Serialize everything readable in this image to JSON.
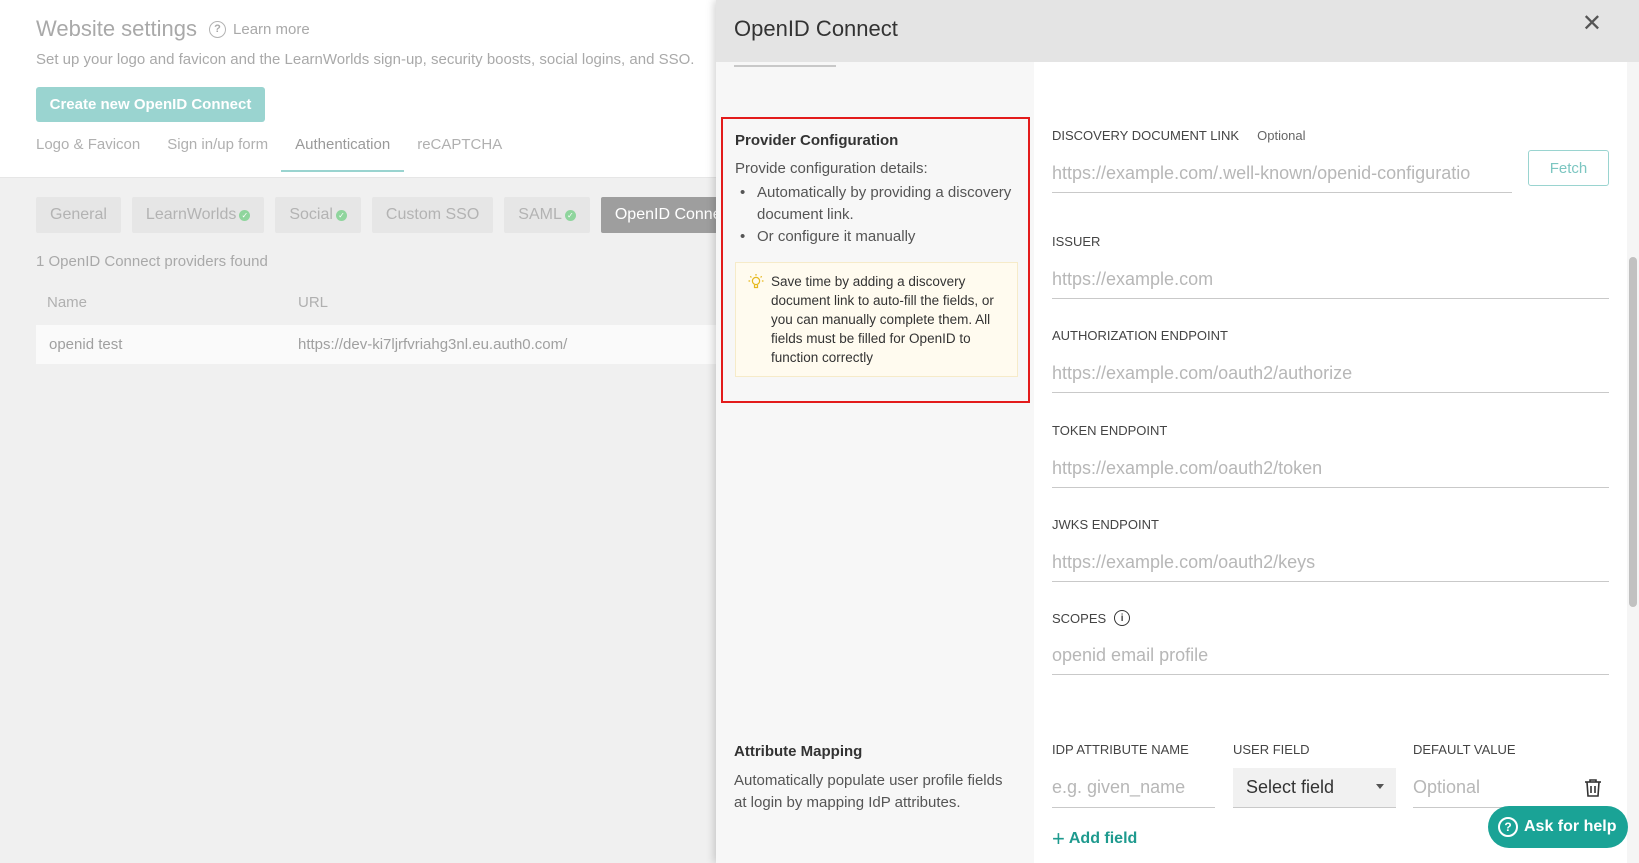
{
  "background": {
    "title": "Website settings",
    "learn_more": "Learn more",
    "subtitle": "Set up your logo and favicon and the LearnWorlds sign-up, security boosts, social logins, and SSO.",
    "create_button": "Create new OpenID Connect",
    "main_tabs": [
      "Logo & Favicon",
      "Sign in/up form",
      "Authentication",
      "reCAPTCHA"
    ],
    "active_main_tab": "Authentication",
    "sub_tabs": [
      "General",
      "LearnWorlds",
      "Social",
      "Custom SSO",
      "SAML",
      "OpenID Conne"
    ],
    "active_sub_tab": "OpenID Conne",
    "providers_found": "1 OpenID Connect providers found",
    "table": {
      "columns": [
        "Name",
        "URL"
      ],
      "rows": [
        [
          "openid test",
          "https://dev-ki7ljrfvriahg3nl.eu.auth0.com/"
        ]
      ]
    }
  },
  "drawer": {
    "title": "OpenID Connect",
    "provider_config": {
      "title": "Provider Configuration",
      "description": "Provide configuration details:",
      "items": [
        "Automatically by providing a discovery document link.",
        "Or configure it manually"
      ],
      "tip": "Save time by adding a discovery document link to auto-fill the fields, or you can manually complete them. All fields must be filled for OpenID to function correctly"
    },
    "fields": {
      "discovery": {
        "label": "DISCOVERY DOCUMENT LINK",
        "optional": "Optional",
        "placeholder": "https://example.com/.well-known/openid-configuratio",
        "button": "Fetch"
      },
      "issuer": {
        "label": "ISSUER",
        "placeholder": "https://example.com"
      },
      "authorization": {
        "label": "AUTHORIZATION ENDPOINT",
        "placeholder": "https://example.com/oauth2/authorize"
      },
      "token": {
        "label": "TOKEN ENDPOINT",
        "placeholder": "https://example.com/oauth2/token"
      },
      "jwks": {
        "label": "JWKS ENDPOINT",
        "placeholder": "https://example.com/oauth2/keys"
      },
      "scopes": {
        "label": "SCOPES",
        "placeholder": "openid email profile"
      }
    },
    "attribute_mapping": {
      "title": "Attribute Mapping",
      "description": "Automatically populate user profile fields at login by mapping IdP attributes.",
      "headers": [
        "IDP ATTRIBUTE NAME",
        "USER FIELD",
        "DEFAULT VALUE"
      ],
      "idp_placeholder": "e.g. given_name",
      "select_value": "Select field",
      "default_placeholder": "Optional",
      "add_field": "Add field"
    }
  },
  "help_button": "Ask for help",
  "colors": {
    "teal": "#1aa396",
    "highlight_red": "#e31b1b",
    "tip_bg": "#fffbef"
  }
}
